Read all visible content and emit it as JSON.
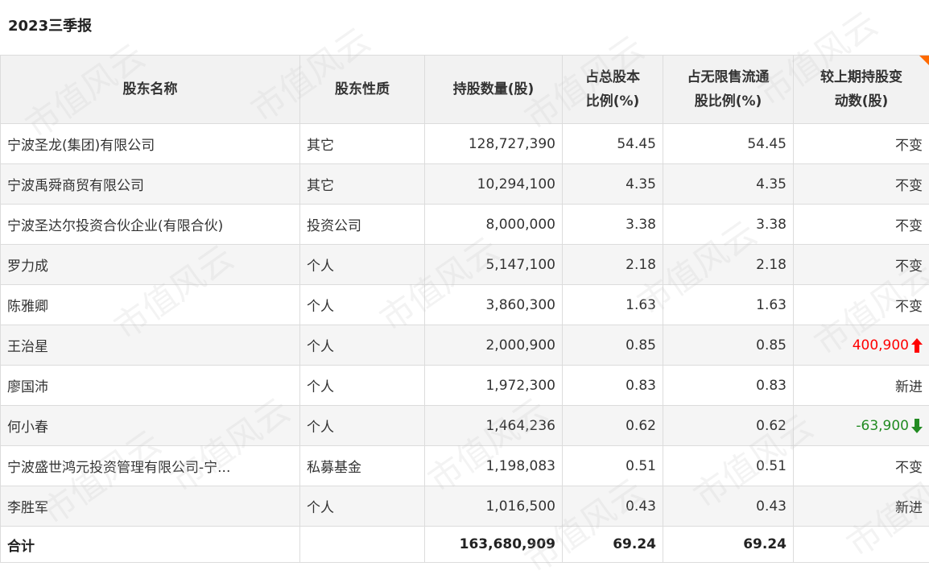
{
  "report_title": "2023三季报",
  "watermark": "市值风云",
  "colors": {
    "header_bg": "#f2f2f2",
    "stripe_bg": "#f5f5f5",
    "up": "#ff0000",
    "down": "#228b22",
    "corner_flag": "#ff6a00"
  },
  "table": {
    "headers": [
      "股东名称",
      "股东性质",
      "持股数量(股)",
      "占总股本比例(%)",
      "占无限售流通股比例(%)",
      "较上期持股变动数(股)"
    ],
    "rows": [
      {
        "name": "宁波圣龙(集团)有限公司",
        "type": "其它",
        "shares": "128,727,390",
        "total_pct": "54.45",
        "float_pct": "54.45",
        "change": "不变",
        "trend": ""
      },
      {
        "name": "宁波禹舜商贸有限公司",
        "type": "其它",
        "shares": "10,294,100",
        "total_pct": "4.35",
        "float_pct": "4.35",
        "change": "不变",
        "trend": ""
      },
      {
        "name": "宁波圣达尔投资合伙企业(有限合伙)",
        "type": "投资公司",
        "shares": "8,000,000",
        "total_pct": "3.38",
        "float_pct": "3.38",
        "change": "不变",
        "trend": ""
      },
      {
        "name": "罗力成",
        "type": "个人",
        "shares": "5,147,100",
        "total_pct": "2.18",
        "float_pct": "2.18",
        "change": "不变",
        "trend": ""
      },
      {
        "name": "陈雅卿",
        "type": "个人",
        "shares": "3,860,300",
        "total_pct": "1.63",
        "float_pct": "1.63",
        "change": "不变",
        "trend": ""
      },
      {
        "name": "王治星",
        "type": "个人",
        "shares": "2,000,900",
        "total_pct": "0.85",
        "float_pct": "0.85",
        "change": "400,900",
        "trend": "up"
      },
      {
        "name": "廖国沛",
        "type": "个人",
        "shares": "1,972,300",
        "total_pct": "0.83",
        "float_pct": "0.83",
        "change": "新进",
        "trend": ""
      },
      {
        "name": "何小春",
        "type": "个人",
        "shares": "1,464,236",
        "total_pct": "0.62",
        "float_pct": "0.62",
        "change": "-63,900",
        "trend": "down"
      },
      {
        "name": "宁波盛世鸿元投资管理有限公司-宁...",
        "type": "私募基金",
        "shares": "1,198,083",
        "total_pct": "0.51",
        "float_pct": "0.51",
        "change": "不变",
        "trend": ""
      },
      {
        "name": "李胜军",
        "type": "个人",
        "shares": "1,016,500",
        "total_pct": "0.43",
        "float_pct": "0.43",
        "change": "新进",
        "trend": ""
      }
    ],
    "total": {
      "label": "合计",
      "shares": "163,680,909",
      "total_pct": "69.24",
      "float_pct": "69.24"
    }
  }
}
